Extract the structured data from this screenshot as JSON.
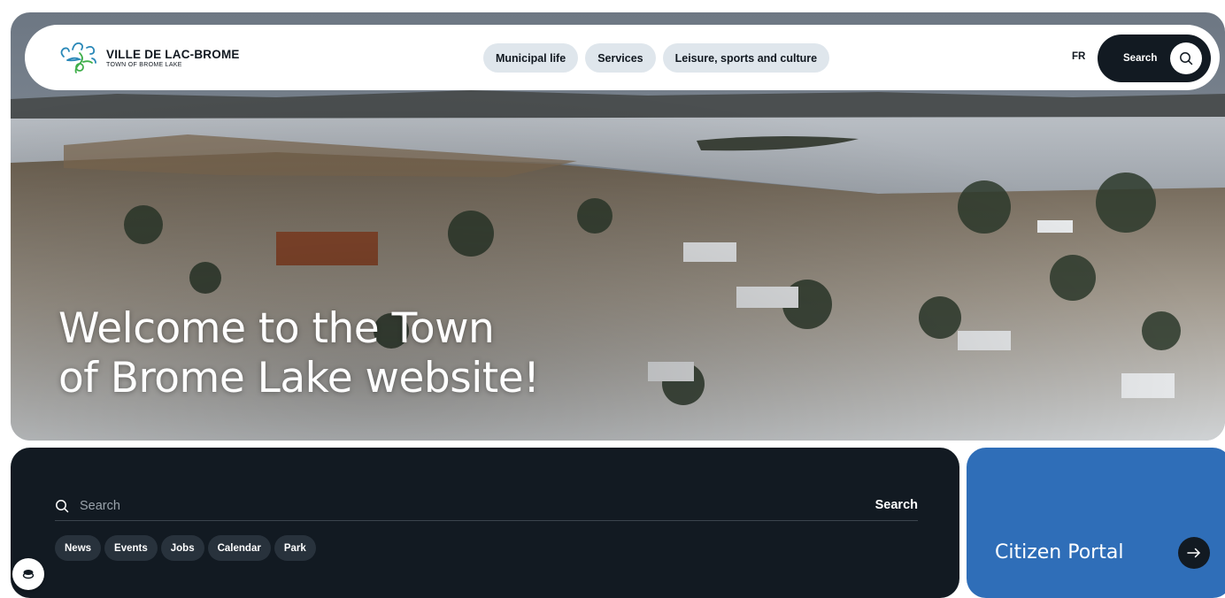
{
  "header": {
    "logo_name": "VILLE DE LAC-BROME",
    "logo_subtitle": "TOWN OF BROME LAKE",
    "nav": [
      {
        "label": "Municipal life"
      },
      {
        "label": "Services"
      },
      {
        "label": "Leisure, sports and culture"
      }
    ],
    "language_toggle": "FR",
    "search_label": "Search"
  },
  "hero": {
    "title_line_1": "Welcome to the Town",
    "title_line_2": "of Brome Lake website!"
  },
  "search_panel": {
    "placeholder": "Search",
    "submit_label": "Search",
    "quick_links": [
      {
        "label": "News"
      },
      {
        "label": "Events"
      },
      {
        "label": "Jobs"
      },
      {
        "label": "Calendar"
      },
      {
        "label": "Park"
      }
    ]
  },
  "portal": {
    "label": "Citizen Portal"
  },
  "colors": {
    "dark": "#121a22",
    "pill": "#dfe6ec",
    "portal_blue": "#2f6eb8"
  },
  "icons": [
    "logo-icon",
    "search-icon",
    "arrow-right-icon",
    "cookie-icon"
  ]
}
